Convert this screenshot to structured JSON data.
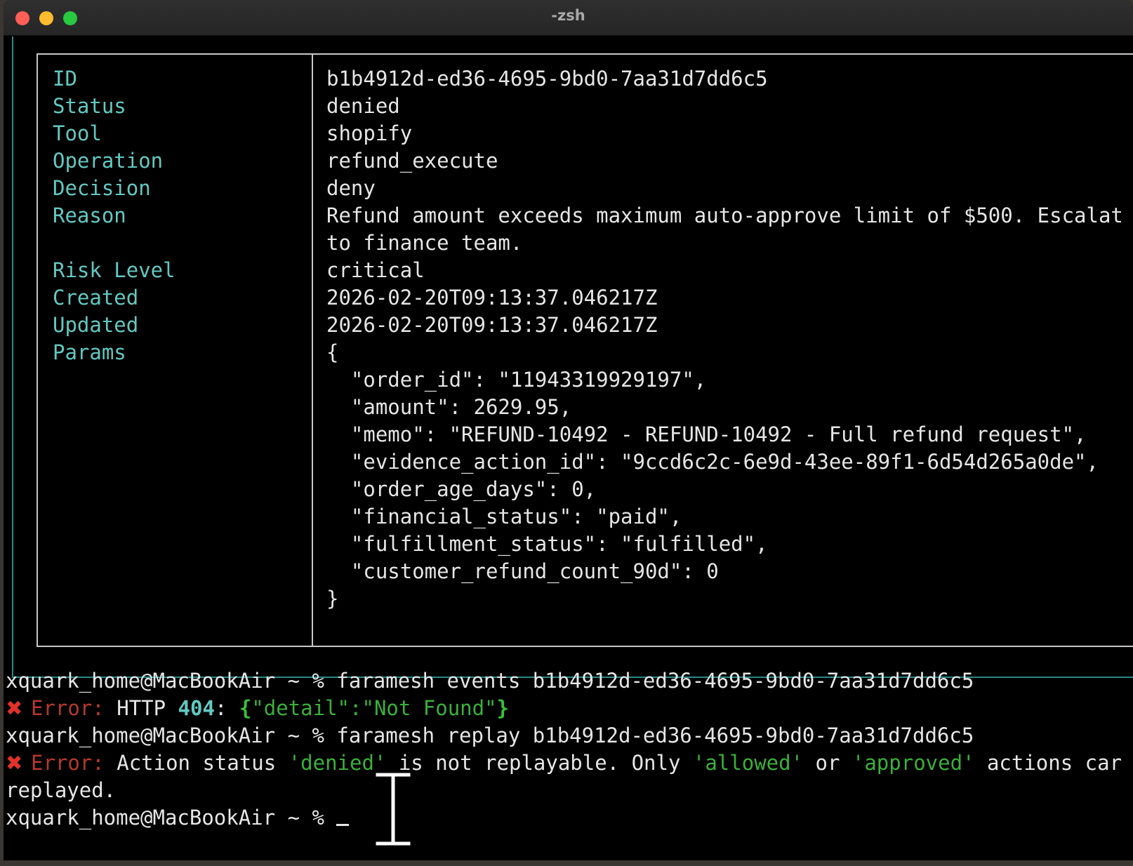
{
  "window": {
    "title": "-zsh"
  },
  "details": {
    "rows": [
      {
        "label": "ID",
        "value": "b1b4912d-ed36-4695-9bd0-7aa31d7dd6c5"
      },
      {
        "label": "Status",
        "value": "denied"
      },
      {
        "label": "Tool",
        "value": "shopify"
      },
      {
        "label": "Operation",
        "value": "refund_execute"
      },
      {
        "label": "Decision",
        "value": "deny"
      },
      {
        "label": "Reason",
        "value": "Refund amount exceeds maximum auto-approve limit of $500. Escalat"
      },
      {
        "label": "",
        "value": "to finance team."
      },
      {
        "label": "Risk Level",
        "value": "critical"
      },
      {
        "label": "Created",
        "value": "2026-02-20T09:13:37.046217Z"
      },
      {
        "label": "Updated",
        "value": "2026-02-20T09:13:37.046217Z"
      },
      {
        "label": "Params",
        "value": "{"
      }
    ],
    "params_lines": [
      "  \"order_id\": \"11943319929197\",",
      "  \"amount\": 2629.95,",
      "  \"memo\": \"REFUND-10492 - REFUND-10492 - Full refund request\",",
      "  \"evidence_action_id\": \"9ccd6c2c-6e9d-43ee-89f1-6d54d265a0de\",",
      "  \"order_age_days\": 0,",
      "  \"financial_status\": \"paid\",",
      "  \"fulfillment_status\": \"fulfilled\",",
      "  \"customer_refund_count_90d\": 0",
      "}"
    ]
  },
  "terminal": {
    "prompt": "xquark_home@MacBookAir ~ %",
    "cmd1": "faramesh events b1b4912d-ed36-4695-9bd0-7aa31d7dd6c5",
    "error_label": "Error:",
    "err1_prefix": "HTTP",
    "err1_code": "404",
    "err1_colon": ":",
    "err1_open": "{",
    "err1_json": "\"detail\":\"Not Found\"",
    "err1_close": "}",
    "cmd2": "faramesh replay b1b4912d-ed36-4695-9bd0-7aa31d7dd6c5",
    "err2_a": "Action status",
    "err2_denied": "'denied'",
    "err2_b": "is not replayable. Only",
    "err2_allowed": "'allowed'",
    "err2_c": "or",
    "err2_approved": "'approved'",
    "err2_d": "actions car",
    "err2_cont": "replayed."
  },
  "icons": {
    "error": "cross-mark-icon",
    "cursor": "text-cursor-icon"
  },
  "colors": {
    "label": "#62c9c1",
    "value": "#e6e6e6",
    "error_x": "#e0322b",
    "error_label": "#b6382d",
    "green": "#3ab03a",
    "border_teal": "#2a8c88"
  }
}
